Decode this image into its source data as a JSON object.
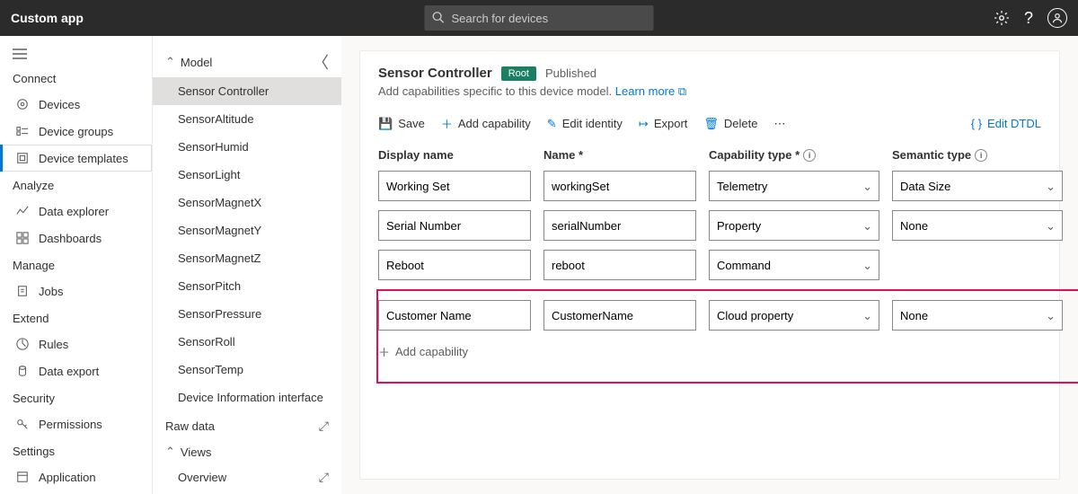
{
  "app": {
    "title": "Custom app"
  },
  "search": {
    "placeholder": "Search for devices"
  },
  "nav": {
    "connect": "Connect",
    "devices": "Devices",
    "device_groups": "Device groups",
    "device_templates": "Device templates",
    "analyze": "Analyze",
    "data_explorer": "Data explorer",
    "dashboards": "Dashboards",
    "manage": "Manage",
    "jobs": "Jobs",
    "extend": "Extend",
    "rules": "Rules",
    "data_export": "Data export",
    "security": "Security",
    "permissions": "Permissions",
    "settings": "Settings",
    "application": "Application"
  },
  "tree": {
    "model": "Model",
    "items": [
      "Sensor Controller",
      "SensorAltitude",
      "SensorHumid",
      "SensorLight",
      "SensorMagnetX",
      "SensorMagnetY",
      "SensorMagnetZ",
      "SensorPitch",
      "SensorPressure",
      "SensorRoll",
      "SensorTemp",
      "Device Information interface"
    ],
    "raw_data": "Raw data",
    "views": "Views",
    "overview": "Overview"
  },
  "detail": {
    "title": "Sensor Controller",
    "badge": "Root",
    "status": "Published",
    "subtext": "Add capabilities specific to this device model.",
    "learn_more": "Learn more",
    "toolbar": {
      "save": "Save",
      "add_capability": "Add capability",
      "edit_identity": "Edit identity",
      "export": "Export",
      "delete": "Delete",
      "edit_dtdl": "Edit DTDL"
    },
    "columns": {
      "display_name": "Display name",
      "name": "Name *",
      "capability_type": "Capability type *",
      "semantic_type": "Semantic type"
    },
    "rows": [
      {
        "display_name": "Working Set",
        "name": "workingSet",
        "capability_type": "Telemetry",
        "semantic_type": "Data Size"
      },
      {
        "display_name": "Serial Number",
        "name": "serialNumber",
        "capability_type": "Property",
        "semantic_type": "None"
      },
      {
        "display_name": "Reboot",
        "name": "reboot",
        "capability_type": "Command",
        "semantic_type": ""
      },
      {
        "display_name": "Customer Name",
        "name": "CustomerName",
        "capability_type": "Cloud property",
        "semantic_type": "None"
      }
    ],
    "add_capability_row": "Add capability"
  }
}
